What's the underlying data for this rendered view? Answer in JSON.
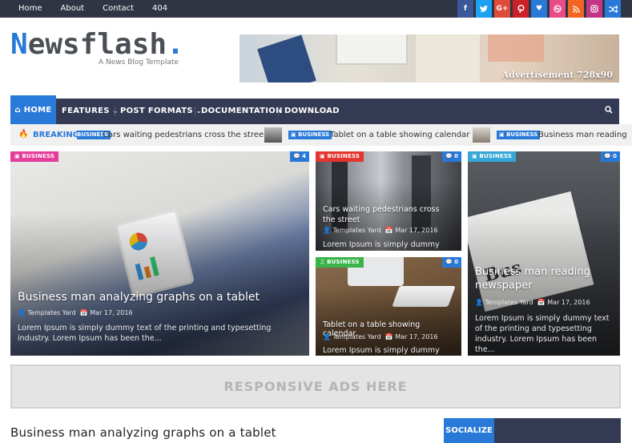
{
  "topnav": [
    "Home",
    "About",
    "Contact",
    "404"
  ],
  "social": [
    {
      "icon": "facebook-icon",
      "glyph": "f",
      "color": "#3b5998"
    },
    {
      "icon": "twitter-icon",
      "glyph": "🐦",
      "color": "#1da1f2"
    },
    {
      "icon": "google-plus-icon",
      "glyph": "G+",
      "color": "#dd4b39"
    },
    {
      "icon": "pinterest-icon",
      "glyph": "P",
      "color": "#cb2027"
    },
    {
      "icon": "heart-icon",
      "glyph": "♥",
      "color": "#2979d9"
    },
    {
      "icon": "dribbble-icon",
      "glyph": "⊛",
      "color": "#ea4c89"
    },
    {
      "icon": "rss-icon",
      "glyph": "≋",
      "color": "#f26522"
    },
    {
      "icon": "instagram-icon",
      "glyph": "◎",
      "color": "#c13584"
    },
    {
      "icon": "random-icon",
      "glyph": "⤭",
      "color": "#2979d9"
    }
  ],
  "logo": {
    "first": "N",
    "rest": "ewsflash",
    "dot": "."
  },
  "tagline": "A News Blog Template",
  "ad_header": "Advertisement 728x90",
  "mainnav": {
    "home": "HOME",
    "features": "FEATURES",
    "post_formats": "POST FORMATS",
    "documentation": "DOCUMENTATION",
    "download": "DOWNLOAD"
  },
  "ticker": {
    "label": "BREAKING",
    "items": [
      {
        "tag": "BUSINESS",
        "title": "Cars waiting pedestrians cross the street"
      },
      {
        "tag": "BUSINESS",
        "title": "Tablet on a table showing calendar"
      },
      {
        "tag": "BUSINESS",
        "title": "Business man reading"
      }
    ]
  },
  "posts": {
    "main": {
      "category": "BUSINESS",
      "comments": "4",
      "title": "Business man analyzing graphs on a tablet",
      "author": "Templates Yard",
      "date": "Mar 17, 2016",
      "excerpt": "Lorem Ipsum is simply dummy text of the printing and typesetting industry. Lorem Ipsum has been the..."
    },
    "street": {
      "category": "BUSINESS",
      "comments": "0",
      "title": "Cars waiting pedestrians cross the street",
      "author": "Templates Yard",
      "date": "Mar 17, 2016",
      "excerpt": "Lorem Ipsum is simply dummy text"
    },
    "tablet": {
      "category": "BUSINESS",
      "comments": "0",
      "title": "Tablet on a table showing calendar",
      "author": "Templates Yard",
      "date": "Mar 17, 2016",
      "excerpt": "Lorem Ipsum is simply dummy text"
    },
    "reading": {
      "category": "BUSINESS",
      "comments": "0",
      "title": "Business man reading newspaper",
      "author": "Templates Yard",
      "date": "Mar 17, 2016",
      "excerpt": "Lorem Ipsum is simply dummy text of the printing and typesetting industry. Lorem Ipsum has been the..."
    }
  },
  "responsive_ad": "RESPONSIVE ADS HERE",
  "section_post_title": "Business man analyzing graphs on a tablet",
  "socialize": "SOCIALIZE",
  "colors": {
    "accent": "#2979d9",
    "nav": "#343a54",
    "cat_business_pink": "#e63d9b",
    "cat_business_red": "#e3342f",
    "cat_business_green": "#38b449",
    "cat_business_cyan": "#35a7d8"
  }
}
